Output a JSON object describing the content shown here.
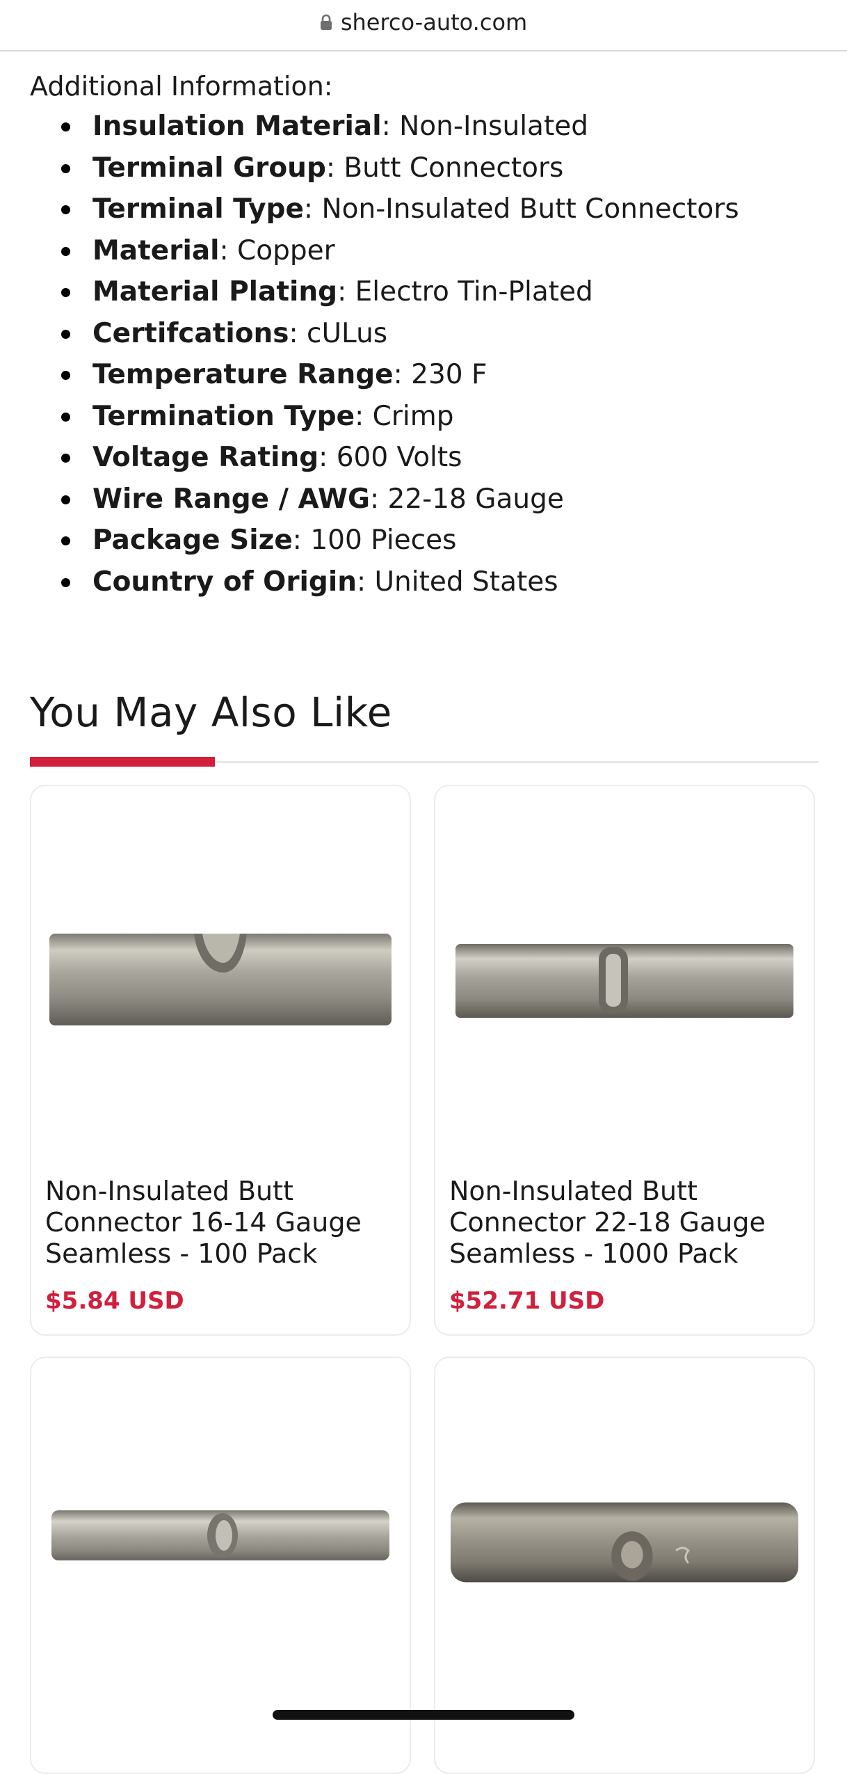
{
  "browser": {
    "url": "sherco-auto.com"
  },
  "additional_info": {
    "title": "Additional Information:",
    "items": [
      {
        "label": "Insulation Material",
        "value": ": Non-Insulated"
      },
      {
        "label": "Terminal Group",
        "value": ": Butt Connectors"
      },
      {
        "label": "Terminal Type",
        "value": ": Non-Insulated Butt Connectors"
      },
      {
        "label": "Material",
        "value": ": Copper"
      },
      {
        "label": "Material Plating",
        "value": ": Electro Tin-Plated"
      },
      {
        "label": "Certifcations",
        "value": ": cULus"
      },
      {
        "label": "Temperature Range",
        "value": ": 230 F"
      },
      {
        "label": "Termination Type",
        "value": ": Crimp"
      },
      {
        "label": "Voltage Rating",
        "value": ": 600 Volts"
      },
      {
        "label": "Wire Range / AWG",
        "value": ": 22-18 Gauge"
      },
      {
        "label": "Package Size",
        "value": ": 100 Pieces"
      },
      {
        "label": "Country of Origin",
        "value": ": United States"
      }
    ]
  },
  "recommendations": {
    "title": "You May Also Like",
    "accent_color": "#d21f3c",
    "products": [
      {
        "title": "Non-Insulated Butt Connector 16-14 Gauge Seamless - 100 Pack",
        "price": "$5.84 USD"
      },
      {
        "title": "Non-Insulated Butt Connector 22-18 Gauge Seamless - 1000 Pack",
        "price": "$52.71 USD"
      },
      {
        "title": "",
        "price": ""
      },
      {
        "title": "",
        "price": ""
      }
    ]
  }
}
